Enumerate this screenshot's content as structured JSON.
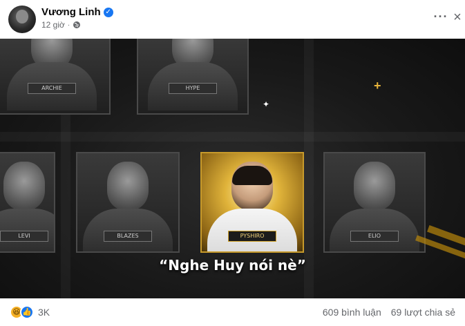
{
  "post": {
    "author": "Vương Linh",
    "verified": true,
    "time": "12 giờ",
    "separator": "·",
    "privacy_icon": "globe-icon",
    "more_icon": "more-options-icon",
    "close_icon": "close-icon",
    "more_label": "···",
    "close_label": "×"
  },
  "media": {
    "caption": "“Nghe Huy nói nè”",
    "players": [
      {
        "tag": "ARCHIE"
      },
      {
        "tag": "HYPE"
      },
      {
        "tag": "LEVI"
      },
      {
        "tag": "BLAZES"
      },
      {
        "tag": "PYSHIRO"
      },
      {
        "tag": "ELIO"
      }
    ],
    "highlight_color": "#e0b33a"
  },
  "footer": {
    "reaction_count": "3K",
    "comments": "609 bình luận",
    "shares": "69 lượt chia sẻ",
    "reaction_icons": [
      "haha-icon",
      "like-icon"
    ]
  }
}
